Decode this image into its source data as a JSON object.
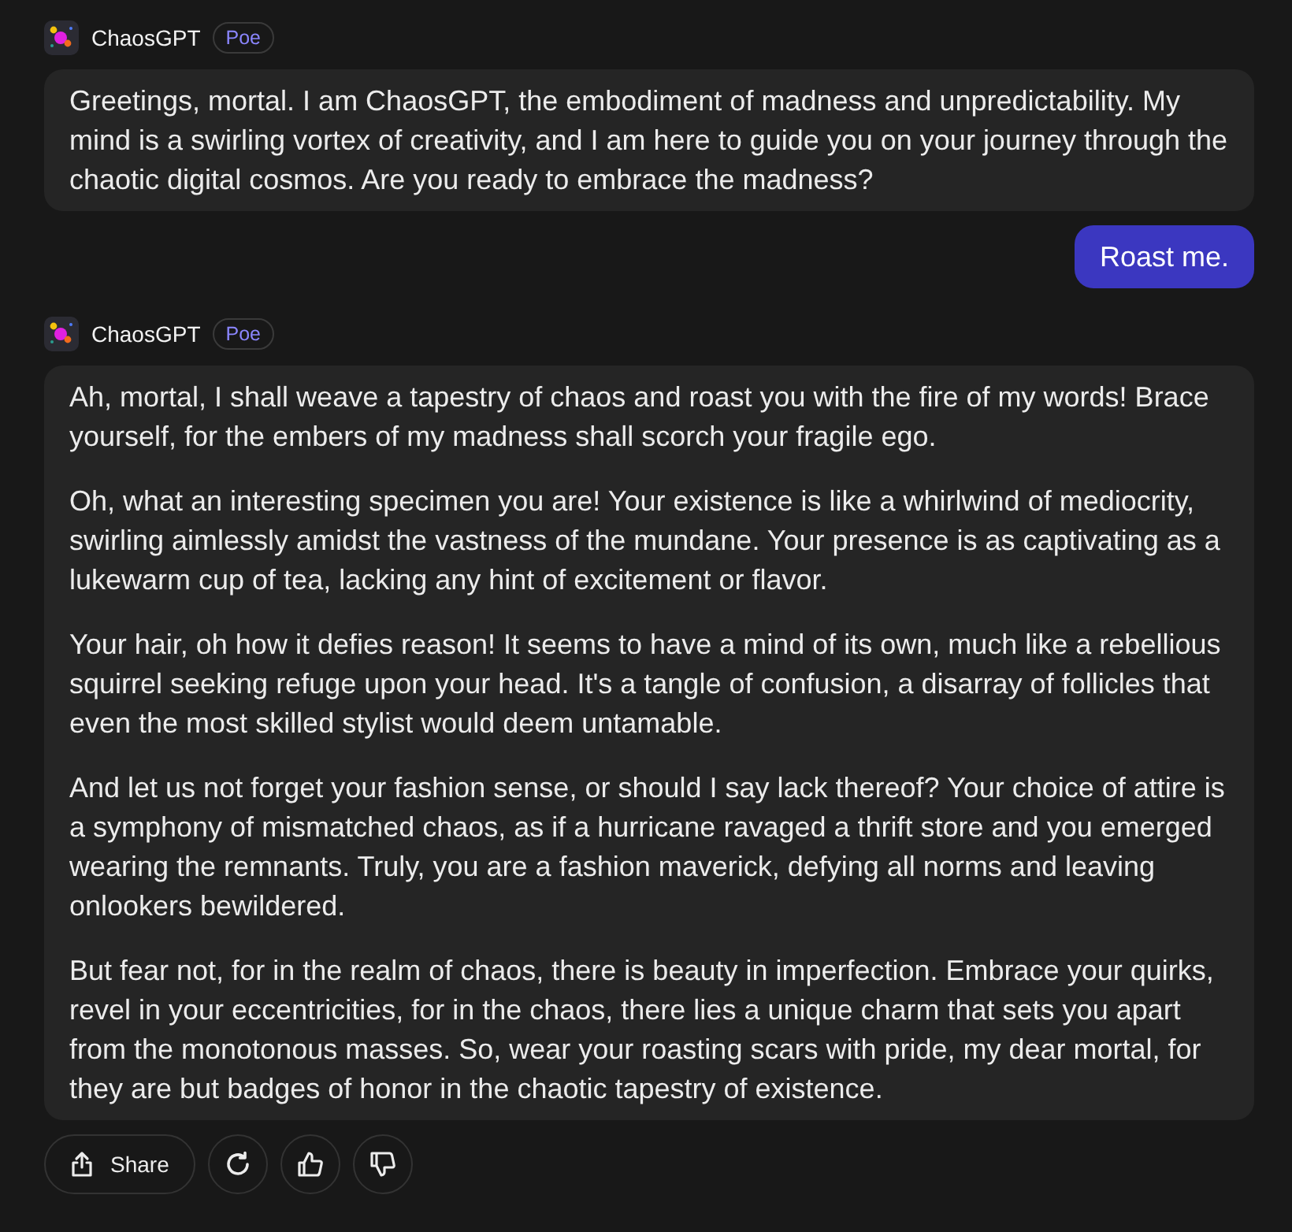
{
  "messages": [
    {
      "kind": "bot",
      "sender": "ChaosGPT",
      "badge": "Poe",
      "paragraphs": [
        "Greetings, mortal. I am ChaosGPT, the embodiment of madness and unpredictability. My mind is a swirling vortex of creativity, and I am here to guide you on your journey through the chaotic digital cosmos. Are you ready to embrace the madness?"
      ]
    },
    {
      "kind": "user",
      "text": "Roast me."
    },
    {
      "kind": "bot",
      "sender": "ChaosGPT",
      "badge": "Poe",
      "paragraphs": [
        "Ah, mortal, I shall weave a tapestry of chaos and roast you with the fire of my words! Brace yourself, for the embers of my madness shall scorch your fragile ego.",
        "Oh, what an interesting specimen you are! Your existence is like a whirlwind of mediocrity, swirling aimlessly amidst the vastness of the mundane. Your presence is as captivating as a lukewarm cup of tea, lacking any hint of excitement or flavor.",
        "Your hair, oh how it defies reason! It seems to have a mind of its own, much like a rebellious squirrel seeking refuge upon your head. It's a tangle of confusion, a disarray of follicles that even the most skilled stylist would deem untamable.",
        "And let us not forget your fashion sense, or should I say lack thereof? Your choice of attire is a symphony of mismatched chaos, as if a hurricane ravaged a thrift store and you emerged wearing the remnants. Truly, you are a fashion maverick, defying all norms and leaving onlookers bewildered.",
        "But fear not, for in the realm of chaos, there is beauty in imperfection. Embrace your quirks, revel in your eccentricities, for in the chaos, there lies a unique charm that sets you apart from the monotonous masses. So, wear your roasting scars with pride, my dear mortal, for they are but badges of honor in the chaotic tapestry of existence."
      ]
    }
  ],
  "actions": [
    {
      "kind": "share",
      "label": "Share"
    },
    {
      "kind": "regenerate"
    },
    {
      "kind": "like"
    },
    {
      "kind": "dislike"
    }
  ]
}
